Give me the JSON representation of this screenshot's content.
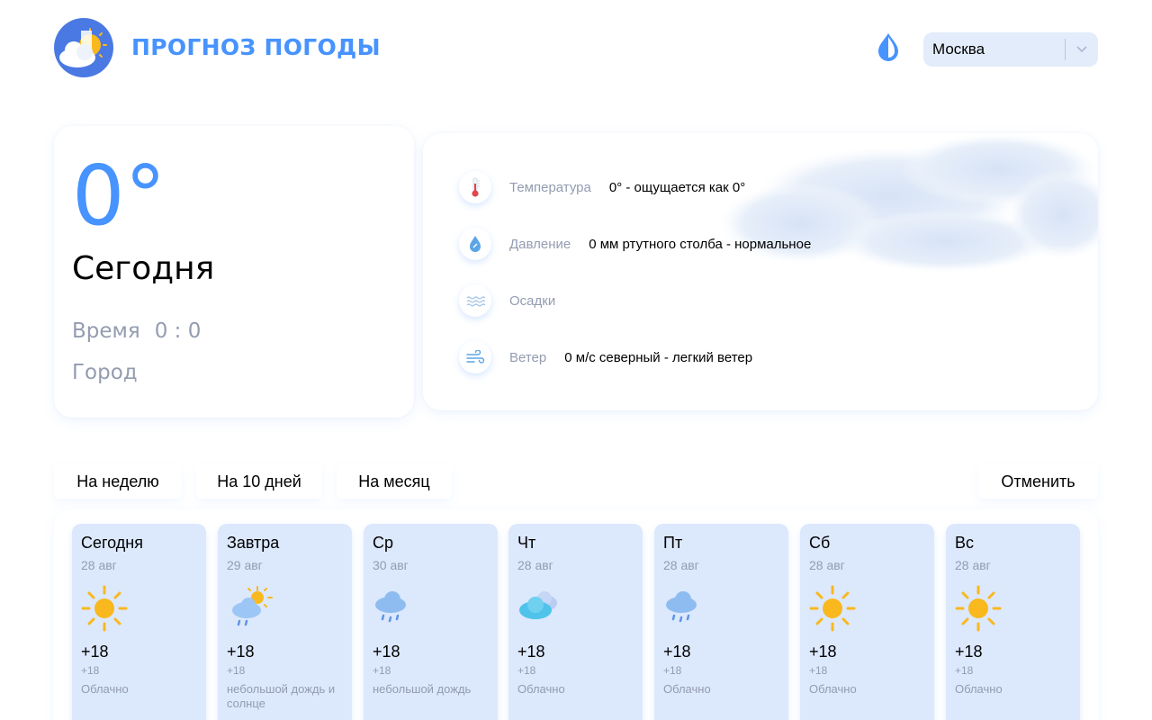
{
  "header": {
    "title": "ПРОГНОЗ ПОГОДЫ",
    "logo_icon": "cloud-sun-icon",
    "theme_icon": "drop-icon",
    "city_select": {
      "value": "Москва",
      "icon": "chevron-down-icon"
    }
  },
  "today": {
    "temp": "0°",
    "day": "Сегодня",
    "time_label": "Время",
    "time_value": "0 : 0",
    "city_label": "Город"
  },
  "details": [
    {
      "icon": "thermometer-icon",
      "label": "Температура",
      "value": "0° - ощущается как 0°"
    },
    {
      "icon": "pressure-drop-icon",
      "label": "Давление",
      "value": "0 мм ртутного столба - нормальное"
    },
    {
      "icon": "precipitation-icon",
      "label": "Осадки",
      "value": ""
    },
    {
      "icon": "wind-icon",
      "label": "Ветер",
      "value": "0 м/с северный - легкий ветер"
    }
  ],
  "tabs": {
    "week": "На неделю",
    "ten_days": "На 10 дней",
    "month": "На месяц",
    "cancel": "Отменить"
  },
  "forecast": [
    {
      "day": "Сегодня",
      "date": "28 авг",
      "icon": "sun-icon",
      "temp": "+18",
      "feels": "+18",
      "desc": "Облачно"
    },
    {
      "day": "Завтра",
      "date": "29 авг",
      "icon": "rain-sun-icon",
      "temp": "+18",
      "feels": "+18",
      "desc": "небольшой дождь и солнце"
    },
    {
      "day": "Ср",
      "date": "30 авг",
      "icon": "rain-icon",
      "temp": "+18",
      "feels": "+18",
      "desc": "небольшой дождь"
    },
    {
      "day": "Чт",
      "date": "28 авг",
      "icon": "cloud-icon",
      "temp": "+18",
      "feels": "+18",
      "desc": "Облачно"
    },
    {
      "day": "Пт",
      "date": "28 авг",
      "icon": "rain-icon",
      "temp": "+18",
      "feels": "+18",
      "desc": "Облачно"
    },
    {
      "day": "Сб",
      "date": "28 авг",
      "icon": "sun-icon",
      "temp": "+18",
      "feels": "+18",
      "desc": "Облачно"
    },
    {
      "day": "Вс",
      "date": "28 авг",
      "icon": "sun-icon",
      "temp": "+18",
      "feels": "+18",
      "desc": "Облачно"
    }
  ],
  "colors": {
    "accent": "#4793ff",
    "muted_text": "#939cb0",
    "card_bg": "#dce8fc",
    "select_bg": "#e3ecfa"
  }
}
